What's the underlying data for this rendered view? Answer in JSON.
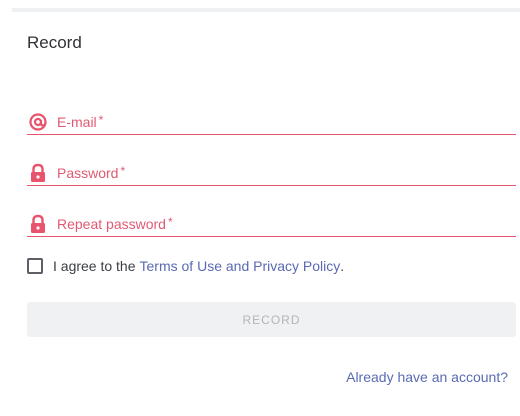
{
  "form": {
    "title": "Record",
    "email": {
      "label": "E-mail",
      "required_mark": "*",
      "icon": "at-icon"
    },
    "password": {
      "label": "Password",
      "required_mark": "*",
      "icon": "lock-icon"
    },
    "repeat_password": {
      "label": "Repeat password",
      "required_mark": "*",
      "icon": "lock-icon"
    },
    "agreement": {
      "text": "I agree to the",
      "link": "Terms of Use and Privacy Policy",
      "suffix": ".",
      "checked": false
    },
    "submit_label": "RECORD",
    "login_link": "Already have an account?"
  },
  "colors": {
    "accent_red": "#e05a73",
    "link_blue": "#5a6ab3",
    "button_bg": "#f0f1f2"
  }
}
